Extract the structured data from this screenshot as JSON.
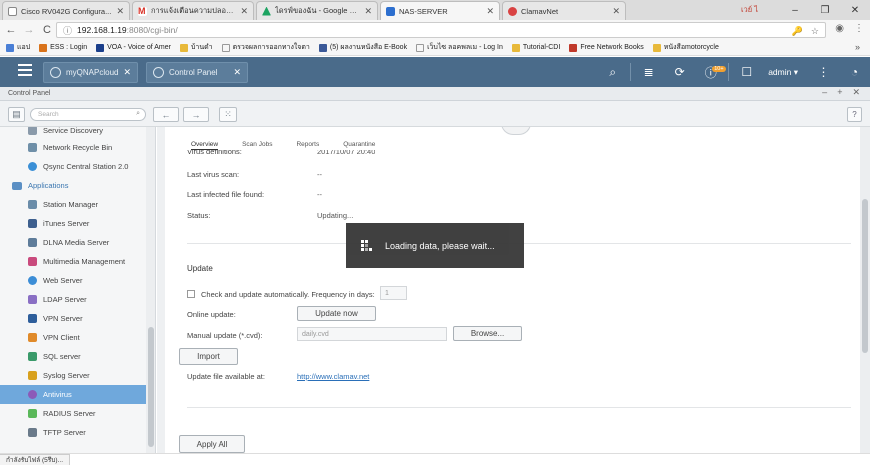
{
  "browser": {
    "tabs": [
      {
        "label": "Cisco RV042G Configura...",
        "color": "#ffffff",
        "active": false
      },
      {
        "label": "การแจ้งเตือนความปลอดภัย -",
        "color": "#d93025",
        "active": false
      },
      {
        "label": "ไดรฟ์ของฉัน - Google ไดรฟ์",
        "color": "#1da462",
        "active": false
      },
      {
        "label": "NAS-SERVER",
        "color": "#2d6fcf",
        "active": true
      },
      {
        "label": "ClamavNet",
        "color": "#d94343",
        "active": false
      }
    ],
    "profile_name": "เวย์ ไ",
    "address": {
      "host": "192.168.1.19",
      "path": ":8080/cgi-bin/"
    },
    "bookmarks": [
      {
        "label": "แอป",
        "color": "#4a7fd6"
      },
      {
        "label": "ESS : Login",
        "color": "#d9731b"
      },
      {
        "label": "VOA - Voice of Amer",
        "color": "#1b3f8b"
      },
      {
        "label": "บ้านดำ",
        "color": "#e8b93a"
      },
      {
        "label": "ตรวจผลการออกทางใจตา",
        "color": "#aaaaaa"
      },
      {
        "label": "(5) ผลงานหนังสือ E-Book",
        "color": "#3b5998"
      },
      {
        "label": "เว็บไซ  ลอคพลเม - Log In",
        "color": "#aaaaaa"
      },
      {
        "label": "Tutorial-CDI",
        "color": "#e8b93a"
      },
      {
        "label": "Free Network Books",
        "color": "#c0392b"
      },
      {
        "label": "หนังสือmotorcycle",
        "color": "#e8b93a"
      }
    ],
    "bookmarks_more": "»",
    "status_text": "กำลังรับไฟล์ (5รึบ)..."
  },
  "qnap": {
    "tabs": [
      {
        "label": "myQNAPcloud"
      },
      {
        "label": "Control Panel"
      }
    ],
    "badge": "10+",
    "user": "admin"
  },
  "control_panel": {
    "title": "Control Panel",
    "search_placeholder": "Search",
    "help_label": "?"
  },
  "sidebar": {
    "items": [
      {
        "label": "Service Discovery",
        "color": "#8a9aaa",
        "selected": false
      },
      {
        "label": "Network Recycle Bin",
        "color": "#6f8fa8",
        "selected": false
      },
      {
        "label": "Qsync Central Station 2.0",
        "color": "#3a8fd6",
        "selected": false
      },
      {
        "label": "Station Manager",
        "color": "#6a8ca9",
        "selected": false
      },
      {
        "label": "iTunes Server",
        "color": "#3d5f8e",
        "selected": false
      },
      {
        "label": "DLNA Media Server",
        "color": "#5e7c9a",
        "selected": false
      },
      {
        "label": "Multimedia Management",
        "color": "#c94a7d",
        "selected": false
      },
      {
        "label": "Web Server",
        "color": "#3c8dd6",
        "selected": false
      },
      {
        "label": "LDAP Server",
        "color": "#8a6fc4",
        "selected": false
      },
      {
        "label": "VPN Server",
        "color": "#2e5e9b",
        "selected": false
      },
      {
        "label": "VPN Client",
        "color": "#e08a2a",
        "selected": false
      },
      {
        "label": "SQL server",
        "color": "#3a9a6a",
        "selected": false
      },
      {
        "label": "Syslog Server",
        "color": "#d8a11e",
        "selected": false
      },
      {
        "label": "Antivirus",
        "color": "#8c5ab8",
        "selected": true
      },
      {
        "label": "RADIUS Server",
        "color": "#5ab85a",
        "selected": false
      },
      {
        "label": "TFTP Server",
        "color": "#6a7a8a",
        "selected": false
      }
    ],
    "group_label": "Applications"
  },
  "antivirus": {
    "subtabs": [
      "Overview",
      "Scan Jobs",
      "Reports",
      "Quarantine"
    ],
    "fields": [
      {
        "label": "Virus definitions:",
        "value": "2017/10/07 20:40"
      },
      {
        "label": "Last virus scan:",
        "value": "--"
      },
      {
        "label": "Last infected file found:",
        "value": "--"
      },
      {
        "label": "Status:",
        "value": "Updating..."
      }
    ],
    "update": {
      "heading": "Update",
      "auto_label": "Check and update automatically. Frequency in days:",
      "frequency_value": "1",
      "online_label": "Online update:",
      "update_now_label": "Update now",
      "manual_label": "Manual update (*.cvd):",
      "manual_placeholder": "daily.cvd",
      "browse_label": "Browse...",
      "import_label": "Import",
      "available_label": "Update file available at:",
      "available_link": "http://www.clamav.net"
    },
    "apply_all_label": "Apply All"
  },
  "loading": {
    "text": "Loading data, please wait..."
  }
}
